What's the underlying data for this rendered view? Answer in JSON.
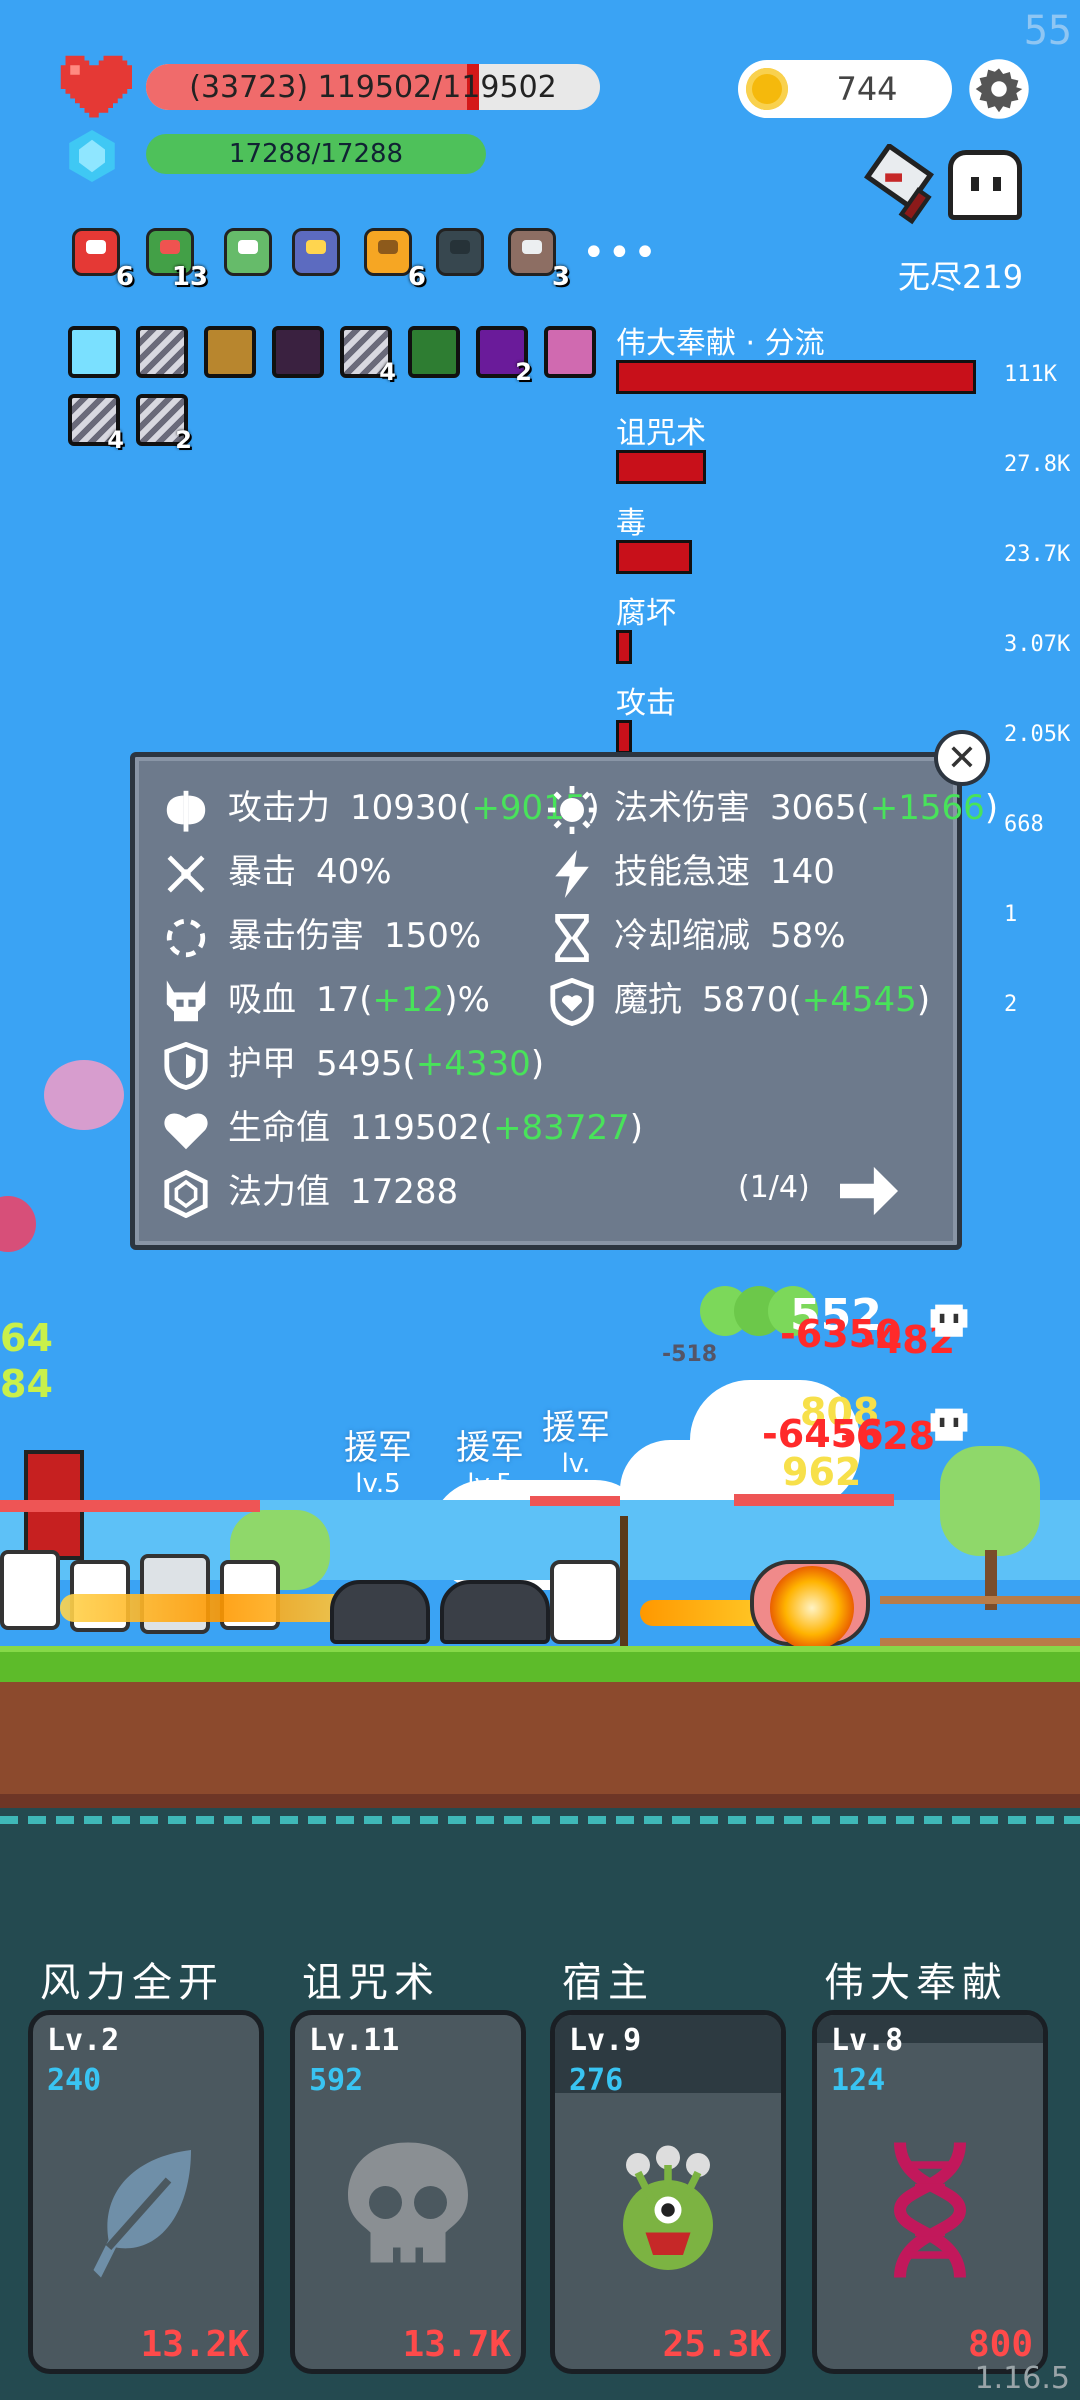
{
  "fps": "55",
  "hp": {
    "text": "(33723) 119502/119502",
    "fill_fraction": 0.72
  },
  "mp": {
    "text": "17288/17288"
  },
  "coins": "744",
  "mode_label": "无尽219",
  "items": [
    {
      "icon": "mushroom-icon",
      "count": "6"
    },
    {
      "icon": "cash-heart-icon",
      "count": "13"
    },
    {
      "icon": "green-card-icon",
      "count": ""
    },
    {
      "icon": "wizard-hat-icon",
      "count": ""
    },
    {
      "icon": "spellbook-icon",
      "count": "6"
    },
    {
      "icon": "bat-icon",
      "count": ""
    },
    {
      "icon": "coconut-icon",
      "count": "3"
    }
  ],
  "items_more": "•••",
  "buffs": [
    {
      "icon": "light-buff-icon",
      "count": ""
    },
    {
      "icon": "slash-buff-icon",
      "count": ""
    },
    {
      "icon": "armor-buff-icon",
      "count": ""
    },
    {
      "icon": "shadow-buff-icon",
      "count": ""
    },
    {
      "icon": "slash-buff-icon",
      "count": "4"
    },
    {
      "icon": "matrix-buff-icon",
      "count": ""
    },
    {
      "icon": "demon-buff-icon",
      "count": "2"
    },
    {
      "icon": "monster-buff-icon",
      "count": ""
    },
    {
      "icon": "slash-buff-icon",
      "count": "4"
    },
    {
      "icon": "slash-buff-icon",
      "count": "2"
    }
  ],
  "damage_meter": [
    {
      "label": "伟大奉献 · 分流",
      "value": "111K",
      "fraction": 1.0
    },
    {
      "label": "诅咒术",
      "value": "27.8K",
      "fraction": 0.25
    },
    {
      "label": "毒",
      "value": "23.7K",
      "fraction": 0.21
    },
    {
      "label": "腐坏",
      "value": "3.07K",
      "fraction": 0.03
    },
    {
      "label": "攻击",
      "value": "2.05K",
      "fraction": 0.02
    },
    {
      "label": "",
      "value": "668",
      "fraction": 0
    },
    {
      "label": "",
      "value": "1",
      "fraction": 0
    },
    {
      "label": "",
      "value": "2",
      "fraction": 0
    }
  ],
  "stats": {
    "attack": {
      "name": "攻击力",
      "value": "10930",
      "bonus": "+9015"
    },
    "spell": {
      "name": "法术伤害",
      "value": "3065",
      "bonus": "+1566"
    },
    "crit": {
      "name": "暴击",
      "value": "40%"
    },
    "haste": {
      "name": "技能急速",
      "value": "140"
    },
    "critdmg": {
      "name": "暴击伤害",
      "value": "150%"
    },
    "cdr": {
      "name": "冷却缩减",
      "value": "58%"
    },
    "lifesteal": {
      "name": "吸血",
      "value": "17",
      "bonus": "+12",
      "suffix": "%"
    },
    "mres": {
      "name": "魔抗",
      "value": "5870",
      "bonus": "+4545"
    },
    "armor": {
      "name": "护甲",
      "value": "5495",
      "bonus": "+4330"
    },
    "life": {
      "name": "生命值",
      "value": "119502",
      "bonus": "+83727"
    },
    "mana": {
      "name": "法力值",
      "value": "17288"
    },
    "page": "(1/4)"
  },
  "battle": {
    "allies": [
      {
        "name": "援军",
        "lv": "lv.5"
      },
      {
        "name": "援军",
        "lv": "lv.5"
      },
      {
        "name": "援军",
        "lv": "lv."
      }
    ],
    "damage_popups": [
      "552",
      "-6350",
      "-482",
      "-518",
      "808",
      "-6456",
      "-628",
      "962",
      "64",
      "84"
    ]
  },
  "skills": [
    {
      "title": "风力全开",
      "lv": "Lv.2",
      "cost": "240",
      "dmg": "13.2K",
      "icon": "feather-icon",
      "cooldown": 0
    },
    {
      "title": "诅咒术",
      "lv": "Lv.11",
      "cost": "592",
      "dmg": "13.7K",
      "icon": "skull-icon",
      "cooldown": 0
    },
    {
      "title": "宿主",
      "lv": "Lv.9",
      "cost": "276",
      "dmg": "25.3K",
      "icon": "parasite-icon",
      "cooldown": 0.22
    },
    {
      "title": "伟大奉献",
      "lv": "Lv.8",
      "cost": "124",
      "dmg": "800",
      "icon": "dna-icon",
      "cooldown": 0.08
    }
  ],
  "version": "1.16.5"
}
